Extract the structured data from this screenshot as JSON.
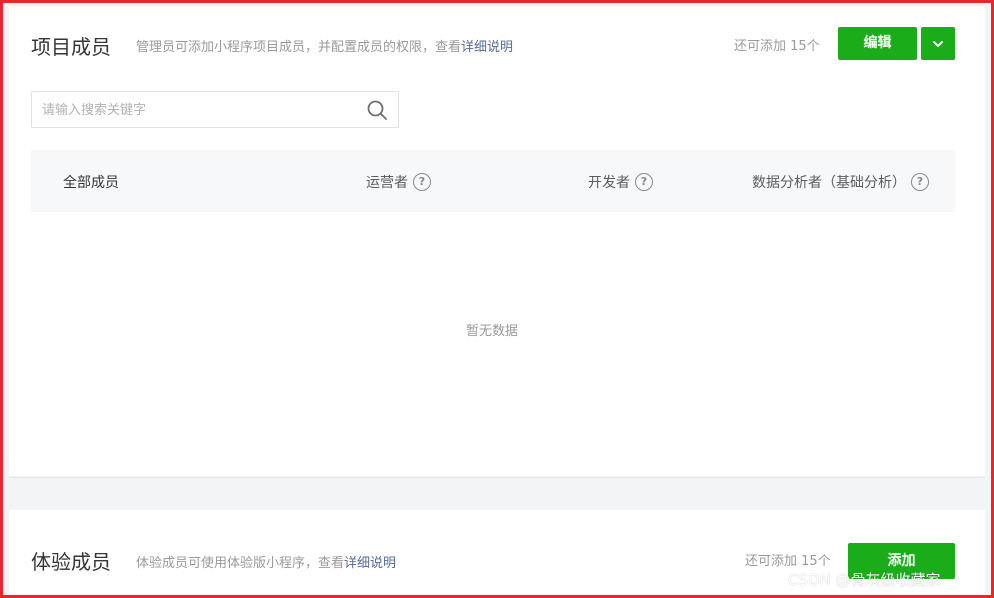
{
  "project_members": {
    "title": "项目成员",
    "desc_text": "管理员可添加小程序项目成员，并配置成员的权限，查看",
    "desc_link": "详细说明",
    "remaining": "还可添加 15个",
    "edit_label": "编辑",
    "search_placeholder": "请输入搜索关键字",
    "columns": [
      "全部成员",
      "运营者",
      "开发者",
      "数据分析者（基础分析）"
    ],
    "empty_text": "暂无数据"
  },
  "experience_members": {
    "title": "体验成员",
    "desc_text": "体验成员可使用体验版小程序，查看",
    "desc_link": "详细说明",
    "remaining": "还可添加 15个",
    "add_label": "添加"
  },
  "watermark": "CSDN @骨灰级收藏家",
  "colors": {
    "accent_green": "#1aad19",
    "link_blue": "#576b95",
    "frame_red": "#e8262c"
  },
  "icons": {
    "search": "search-icon",
    "dropdown": "chevron-down-icon",
    "help": "question-circle-icon"
  }
}
